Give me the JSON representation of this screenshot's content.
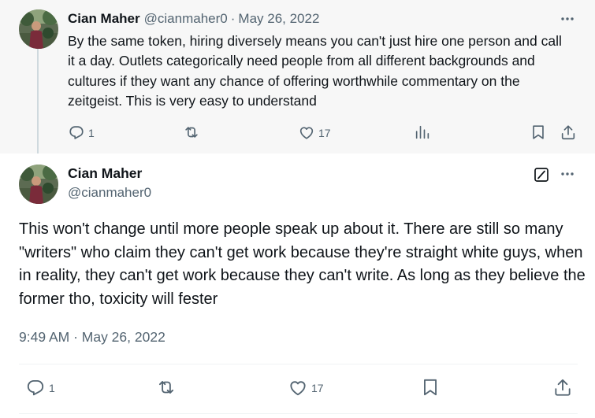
{
  "parent_tweet": {
    "author_name": "Cian Maher",
    "author_handle": "@cianmaher0",
    "separator": "·",
    "date": "May 26, 2022",
    "text": "By the same token, hiring diversely means you can't just hire one person and call it a day. Outlets categorically need people from all different backgrounds and cultures if they want any chance of offering worthwhile commentary on the zeitgeist. This is very easy to understand",
    "actions": {
      "replies": "1",
      "retweets": "",
      "likes": "17"
    }
  },
  "main_tweet": {
    "author_name": "Cian Maher",
    "author_handle": "@cianmaher0",
    "text": "This won't change until more people speak up about it. There are still so many \"writers\" who claim they can't get work because they're straight white guys, when in reality, they can't get work because they can't write. As long as they believe the former tho, toxicity will fester",
    "timestamp": "9:49 AM · May 26, 2022",
    "actions": {
      "replies": "1",
      "retweets": "",
      "likes": "17"
    }
  },
  "icons": {
    "reply": "reply-icon",
    "retweet": "retweet-icon",
    "like": "heart-icon",
    "views": "views-icon",
    "bookmark": "bookmark-icon",
    "share": "share-icon",
    "more": "more-options-icon",
    "grok": "grok-icon"
  },
  "colors": {
    "text_primary": "#0f1419",
    "text_secondary": "#536471",
    "parent_background": "#f7f7f7",
    "thread_line": "#cfd9de",
    "divider": "#eff3f4"
  }
}
